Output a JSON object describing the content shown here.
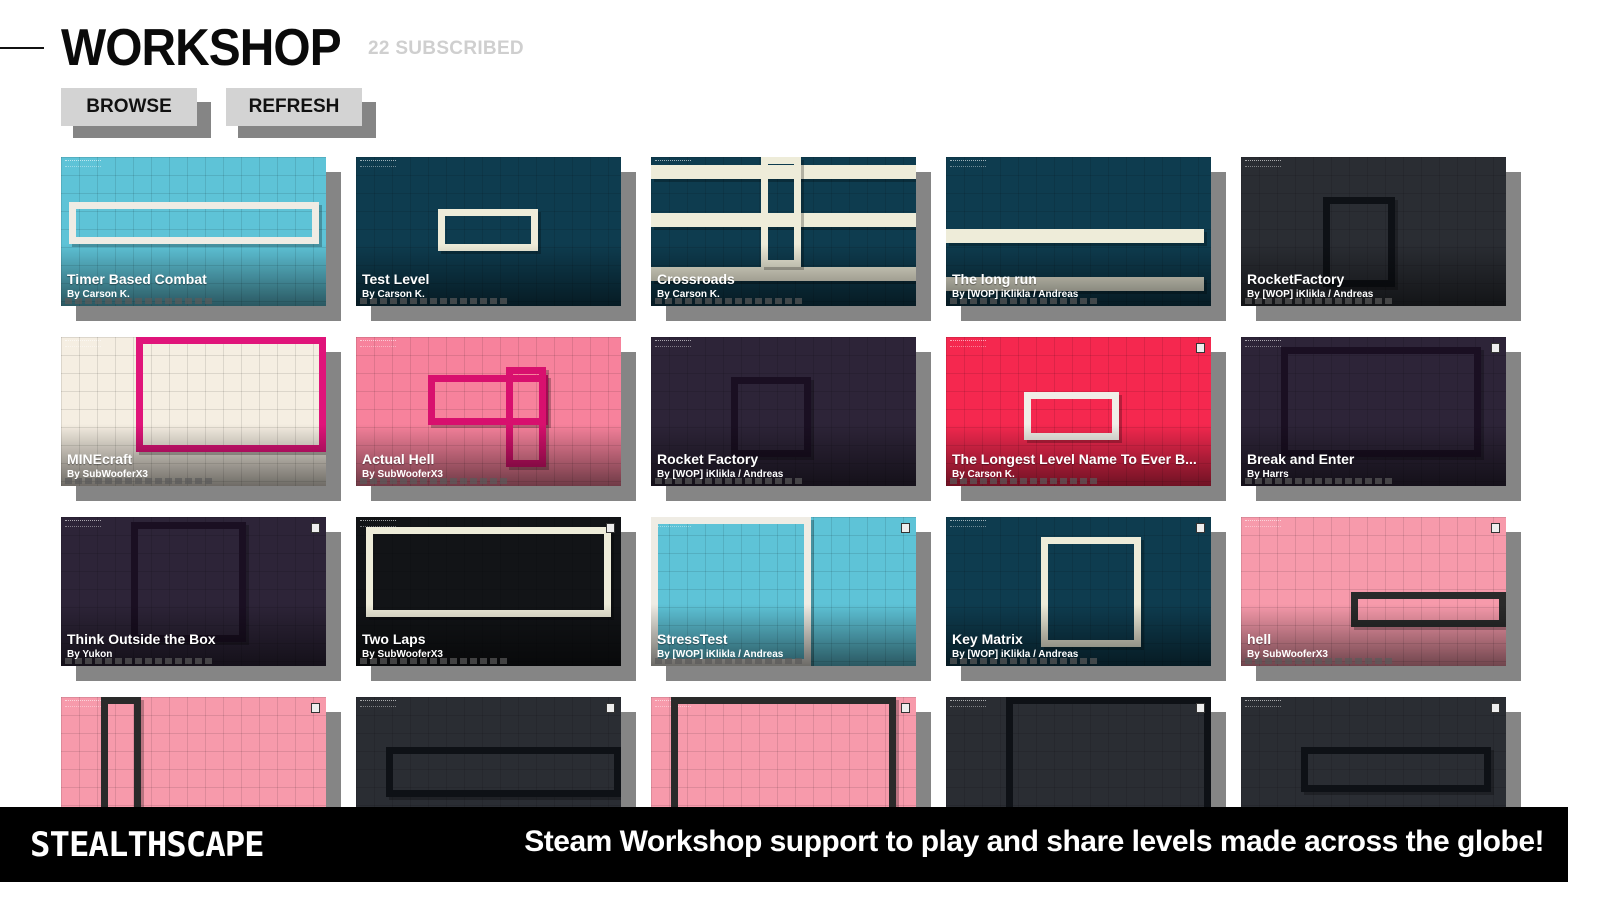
{
  "header": {
    "title": "WORKSHOP",
    "subscribed": "22 SUBSCRIBED"
  },
  "buttons": {
    "browse": "BROWSE",
    "refresh": "REFRESH"
  },
  "levels": [
    {
      "name": "Timer Based Combat",
      "author": "By Carson K.",
      "bg": "#5ec3d7",
      "wall": "#efece4",
      "theme": "cyan"
    },
    {
      "name": "Test Level",
      "author": "By Carson K.",
      "bg": "#0e3c4f",
      "wall": "#eeecd9",
      "theme": "teal"
    },
    {
      "name": "Crossroads",
      "author": "By Carson K.",
      "bg": "#0e3c4f",
      "wall": "#eeecd9",
      "theme": "teal"
    },
    {
      "name": "The long run",
      "author": "By [WOP] iKlikla / Andreas",
      "bg": "#0e3c4f",
      "wall": "#eeecd9",
      "theme": "teal"
    },
    {
      "name": "RocketFactory",
      "author": "By [WOP] iKlikla / Andreas",
      "bg": "#2a2d33",
      "wall": "#0e1116",
      "theme": "dark"
    },
    {
      "name": "MINEcraft",
      "author": "By SubWooferX3",
      "bg": "#f5eee2",
      "wall": "#e0147a",
      "theme": "cream"
    },
    {
      "name": "Actual Hell",
      "author": "By SubWooferX3",
      "bg": "#f7829c",
      "wall": "#d8106e",
      "theme": "pink"
    },
    {
      "name": "Rocket    Factory",
      "author": "By [WOP] iKlikla / Andreas",
      "bg": "#2d2438",
      "wall": "#1a0f22",
      "theme": "purple"
    },
    {
      "name": "The Longest Level Name To Ever B...",
      "author": "By Carson K.",
      "bg": "#f5284f",
      "wall": "#f0efe8",
      "theme": "red"
    },
    {
      "name": "Break and Enter",
      "author": "By Harrs",
      "bg": "#2d2438",
      "wall": "#1a0f22",
      "theme": "purple"
    },
    {
      "name": "Think Outside the Box",
      "author": "By Yukon",
      "bg": "#2d2438",
      "wall": "#1a0f22",
      "theme": "purple"
    },
    {
      "name": "Two Laps",
      "author": "By SubWooferX3",
      "bg": "#121417",
      "wall": "#eeecd9",
      "theme": "black"
    },
    {
      "name": "StressTest",
      "author": "By [WOP] iKlikla / Andreas",
      "bg": "#5ec3d7",
      "wall": "#efece4",
      "theme": "cyan"
    },
    {
      "name": "Key Matrix",
      "author": "By [WOP] iKlikla / Andreas",
      "bg": "#0e3c4f",
      "wall": "#eeecd9",
      "theme": "teal"
    },
    {
      "name": "hell",
      "author": "By SubWooferX3",
      "bg": "#f79aab",
      "wall": "#2a2a2a",
      "theme": "lightpink"
    },
    {
      "name": "",
      "author": "",
      "bg": "#f79aab",
      "wall": "#2a2a2a",
      "theme": "lightpink"
    },
    {
      "name": "",
      "author": "",
      "bg": "#2a2d33",
      "wall": "#0e1116",
      "theme": "dark"
    },
    {
      "name": "",
      "author": "",
      "bg": "#f79aab",
      "wall": "#2a2a2a",
      "theme": "lightpink"
    },
    {
      "name": "",
      "author": "",
      "bg": "#2a2d33",
      "wall": "#0e1116",
      "theme": "dark"
    },
    {
      "name": "",
      "author": "",
      "bg": "#2a2d33",
      "wall": "#0e1116",
      "theme": "dark"
    }
  ],
  "footer": {
    "logo": "STEALTHSCAPE",
    "tagline": "Steam Workshop support to play and share levels made across the globe!"
  }
}
